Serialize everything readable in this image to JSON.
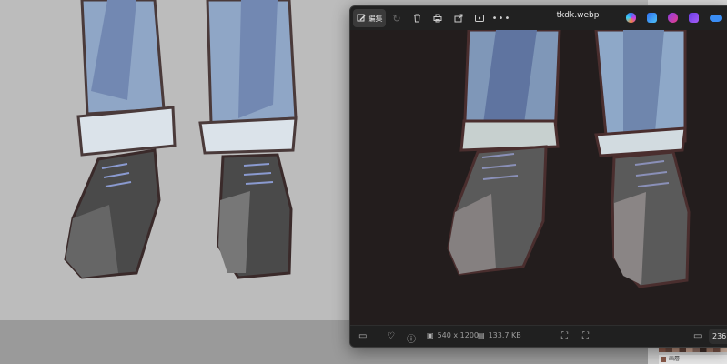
{
  "viewer": {
    "edit_label": "編集",
    "file_name": "tkdk.webp",
    "dimensions": "540 x 1200",
    "file_size": "133.7 KB",
    "zoom": "236"
  },
  "layers": {
    "layer_name": "画層"
  },
  "icons": {
    "edit": "edit-icon",
    "rotate": "rotate-icon",
    "delete": "trash-icon",
    "print": "print-icon",
    "share": "share-icon",
    "slideshow": "slideshow-icon",
    "more": "more-icon",
    "copilot": "copilot-icon",
    "designer": "designer-icon",
    "clipchamp": "clipchamp-icon",
    "onedrive": "onedrive-icon",
    "filmstrip": "filmstrip-icon",
    "favorite": "heart-icon",
    "info": "info-icon",
    "fit": "fit-screen-icon",
    "fullscreen": "fullscreen-icon"
  },
  "colors": {
    "viewer_bg": "#212121",
    "image_bg": "#231d1d",
    "canvas_bg": "#bcbcbc",
    "denim": "#8ea4c2",
    "shoe_dark": "#4b4b4b"
  }
}
